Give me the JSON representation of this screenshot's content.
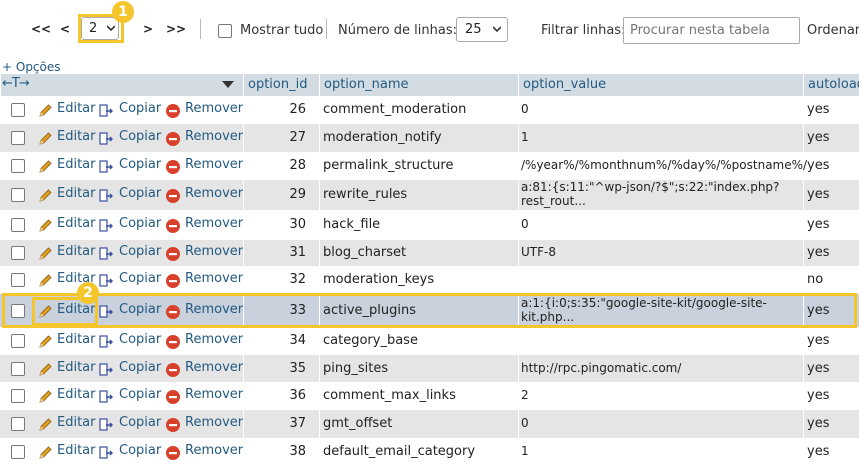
{
  "nav": {
    "first": "<<",
    "prev": "<",
    "next": ">",
    "last": ">>",
    "page_value": "2",
    "show_all_label": "Mostrar tudo",
    "rows_label": "Número de linhas:",
    "rows_value": "25",
    "filter_label": "Filtrar linhas:",
    "filter_placeholder": "Procurar nesta tabela",
    "order_label": "Ordenar"
  },
  "markers": {
    "one": "1",
    "two": "2"
  },
  "options_link": "+ Opções",
  "arrows_text": "←T→",
  "columns": [
    "option_id",
    "option_name",
    "option_value",
    "autoload"
  ],
  "actions": {
    "edit": "Editar",
    "copy": "Copiar",
    "delete": "Remover"
  },
  "rows": [
    {
      "id": "26",
      "name": "comment_moderation",
      "value": "0",
      "autoload": "yes"
    },
    {
      "id": "27",
      "name": "moderation_notify",
      "value": "1",
      "autoload": "yes"
    },
    {
      "id": "28",
      "name": "permalink_structure",
      "value": "/%year%/%monthnum%/%day%/%postname%/",
      "autoload": "yes"
    },
    {
      "id": "29",
      "name": "rewrite_rules",
      "value": "a:81:{s:11:\"^wp-json/?$\";s:22:\"index.php?rest_rout...",
      "autoload": "yes"
    },
    {
      "id": "30",
      "name": "hack_file",
      "value": "0",
      "autoload": "yes"
    },
    {
      "id": "31",
      "name": "blog_charset",
      "value": "UTF-8",
      "autoload": "yes"
    },
    {
      "id": "32",
      "name": "moderation_keys",
      "value": "",
      "autoload": "no"
    },
    {
      "id": "33",
      "name": "active_plugins",
      "value": "a:1:{i:0;s:35:\"google-site-kit/google-site-kit.php...",
      "autoload": "yes"
    },
    {
      "id": "34",
      "name": "category_base",
      "value": "",
      "autoload": "yes"
    },
    {
      "id": "35",
      "name": "ping_sites",
      "value": "http://rpc.pingomatic.com/",
      "autoload": "yes"
    },
    {
      "id": "36",
      "name": "comment_max_links",
      "value": "2",
      "autoload": "yes"
    },
    {
      "id": "37",
      "name": "gmt_offset",
      "value": "0",
      "autoload": "yes"
    },
    {
      "id": "38",
      "name": "default_email_category",
      "value": "1",
      "autoload": "yes"
    }
  ],
  "colors": {
    "accent": "#f4c62b",
    "link": "#235a81",
    "header_bg": "#d3dce3",
    "row_alt": "#e5e5e5",
    "row_selected": "#c8d1dc",
    "delete_red": "#d9402b",
    "pencil": "#e0a020"
  },
  "icons": {
    "edit": "pencil-icon",
    "copy": "copy-icon",
    "delete": "delete-icon"
  }
}
